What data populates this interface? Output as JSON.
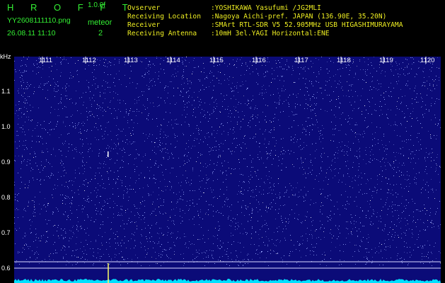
{
  "header": {
    "title": "H R O F F T",
    "version": "1.0.0f",
    "filename": "YY2608111110.png",
    "datetime": "26.08.11 11:10",
    "meteor_label": "meteor",
    "meteor_count": "2",
    "info": [
      {
        "key": "Ovserver",
        "value": ":YOSHIKAWA Yasufumi /JG2MLI"
      },
      {
        "key": "Receiving Location",
        "value": ":Nagoya Aichi-pref. JAPAN (136.90E, 35.20N)"
      },
      {
        "key": "Receiver",
        "value": ":SMArt RTL-SDR V5 52.905MHz USB HIGASHIMURAYAMA"
      },
      {
        "key": "Receiving Antenna",
        "value": ":10mH 3el.YAGI Horizontal:ENE"
      }
    ]
  },
  "spectrogram": {
    "y_unit": "kHz",
    "y_ticks": [
      "1.1",
      "1.0",
      "0.9",
      "0.8",
      "0.7",
      "0.6"
    ],
    "x_ticks": [
      "1111",
      "1112",
      "1113",
      "1114",
      "1115",
      "1116",
      "1117",
      "1118",
      "1119",
      "1120"
    ],
    "colors": {
      "background": "#0b0b78",
      "noise": "#9aaaff",
      "signal": "#ffffff",
      "baseline": "#00e0ff",
      "marker": "#ffff66"
    }
  }
}
